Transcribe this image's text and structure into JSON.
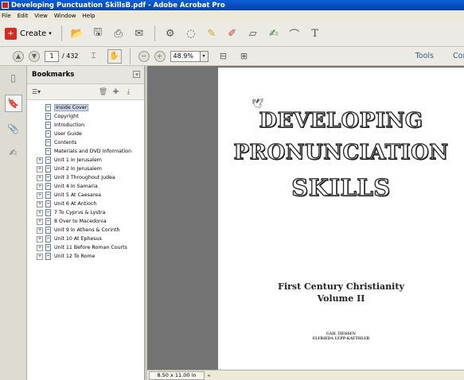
{
  "window": {
    "title": "Developing Punctuation SkillsB.pdf - Adobe Acrobat Pro"
  },
  "menu": {
    "items": [
      "File",
      "Edit",
      "View",
      "Window",
      "Help"
    ]
  },
  "toolbar": {
    "create_label": "Create",
    "icons": [
      "open-icon",
      "save-icon",
      "print-icon",
      "email-icon",
      "settings-icon",
      "comment-icon",
      "highlight-icon",
      "edit-icon",
      "extract-icon",
      "sign-icon",
      "attach-icon",
      "text-icon"
    ],
    "text_icon_glyph": "T"
  },
  "nav": {
    "current_page": "1",
    "total_pages": "/ 432",
    "zoom": "48.9%",
    "tools_label": "Tools",
    "comment_label": "Comment"
  },
  "bookmarks": {
    "title": "Bookmarks",
    "items": [
      {
        "label": "Inside Cover",
        "expandable": false,
        "selected": true
      },
      {
        "label": "Copyright",
        "expandable": false
      },
      {
        "label": "Introduction",
        "expandable": false
      },
      {
        "label": "User Guide",
        "expandable": false
      },
      {
        "label": "Contents",
        "expandable": false
      },
      {
        "label": "Materials and DVD Information",
        "expandable": false
      },
      {
        "label": "Unit 1 In Jerusalem",
        "expandable": true
      },
      {
        "label": "Unit 2 In Jerusalem",
        "expandable": true
      },
      {
        "label": "Unit 3 Throughout Judea",
        "expandable": true
      },
      {
        "label": "Unit 4 In Samaria",
        "expandable": true
      },
      {
        "label": "Unit 5 At Caesarea",
        "expandable": true
      },
      {
        "label": "Unit 6 At Antioch",
        "expandable": true
      },
      {
        "label": "7 To Cyprus & Lystra",
        "expandable": true
      },
      {
        "label": "8 Over to Macedonia",
        "expandable": true
      },
      {
        "label": "Unit 9 In Athens & Corinth",
        "expandable": true
      },
      {
        "label": "Unit 10 At Ephesus",
        "expandable": true
      },
      {
        "label": "Unit 11 Before Roman Courts",
        "expandable": true
      },
      {
        "label": "Unit 12 To Rome",
        "expandable": true
      }
    ]
  },
  "document": {
    "title_line1": "DEVELOPING",
    "title_line2": "PRONUNCIATION",
    "title_line3": "SKILLS",
    "subtitle_line1": "First Century Christianity",
    "subtitle_line2": "Volume II",
    "author1": "GAIL TIESSEN",
    "author2": "ELFRIEDA LEPP-KAETHLER"
  },
  "status": {
    "page_size": "8.50 x 11.00 in"
  }
}
